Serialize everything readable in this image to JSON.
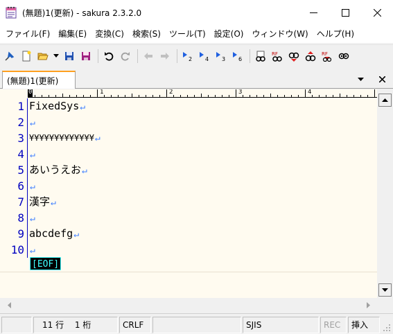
{
  "window": {
    "title": "(無題)1(更新) - sakura 2.3.2.0"
  },
  "menu": [
    {
      "label": "ファイル(F)"
    },
    {
      "label": "編集(E)"
    },
    {
      "label": "変換(C)"
    },
    {
      "label": "検索(S)"
    },
    {
      "label": "ツール(T)"
    },
    {
      "label": "設定(O)"
    },
    {
      "label": "ウィンドウ(W)"
    },
    {
      "label": "ヘルプ(H)"
    }
  ],
  "toolbar": {
    "icons": [
      "pin-icon",
      "new-file-icon",
      "open-folder-icon",
      "dropdown-arrow-icon",
      "save-icon",
      "save-all-icon",
      "undo-icon",
      "redo-icon",
      "move-back-icon",
      "move-forward-icon",
      "jump-2-icon",
      "jump-4-icon",
      "jump-3-icon",
      "jump-6-icon",
      "search-icon",
      "grep-icon",
      "search-next-icon",
      "search-prev-icon",
      "replace-icon",
      "compare-icon"
    ],
    "jump_labels": [
      "2",
      "4",
      "3",
      "6"
    ]
  },
  "tab": {
    "label": "(無題)1(更新)"
  },
  "ruler": {
    "numbers": [
      "0",
      "1",
      "2",
      "3",
      "4"
    ]
  },
  "editor": {
    "lines": [
      {
        "num": "1",
        "text": "FixedSys"
      },
      {
        "num": "2",
        "text": ""
      },
      {
        "num": "3",
        "text": "¥¥¥¥¥¥¥¥¥¥¥¥¥"
      },
      {
        "num": "4",
        "text": ""
      },
      {
        "num": "5",
        "text": "あいうえお"
      },
      {
        "num": "6",
        "text": ""
      },
      {
        "num": "7",
        "text": "漢字"
      },
      {
        "num": "8",
        "text": ""
      },
      {
        "num": "9",
        "text": "abcdefg"
      },
      {
        "num": "10",
        "text": ""
      }
    ],
    "eol_glyph": "↵",
    "eof_label": "[EOF]"
  },
  "statusbar": {
    "position": "11 行　 1 桁",
    "line_ending": "CRLF",
    "encoding": "SJIS",
    "rec": "REC",
    "mode": "挿入"
  },
  "colors": {
    "editor_bg": "#fffbf0",
    "line_number": "#0000c0",
    "eol_mark": "#4080ff",
    "eof_fg": "#40ffff",
    "tab_accent": "#ffa020"
  }
}
